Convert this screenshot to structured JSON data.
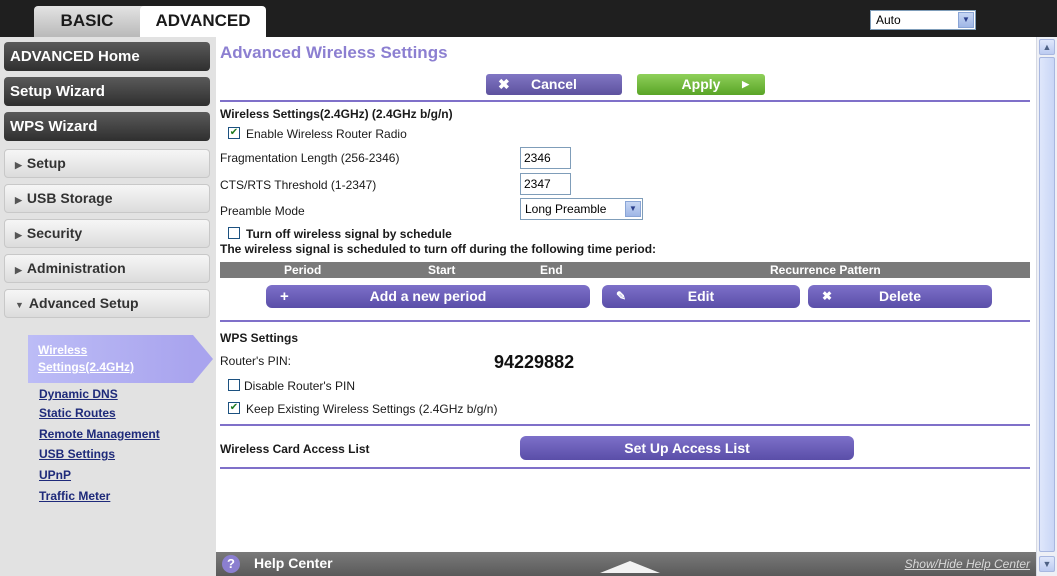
{
  "tabs": {
    "basic": "BASIC",
    "advanced": "ADVANCED"
  },
  "language": {
    "selected": "Auto"
  },
  "sidebar": {
    "main_items": [
      "ADVANCED Home",
      "Setup Wizard",
      "WPS Wizard"
    ],
    "sections": [
      "Setup",
      "USB Storage",
      "Security",
      "Administration",
      "Advanced Setup"
    ],
    "active_sub": "Wireless Settings(2.4GHz)",
    "sub_items": [
      "Dynamic DNS",
      "Static Routes",
      "Remote Management",
      "USB Settings",
      "UPnP",
      "Traffic Meter"
    ]
  },
  "page": {
    "title": "Advanced Wireless Settings",
    "cancel_label": "Cancel",
    "apply_label": "Apply"
  },
  "wireless": {
    "heading": "Wireless Settings(2.4GHz) (2.4GHz b/g/n)",
    "enable_radio_label": "Enable Wireless Router Radio",
    "enable_radio_checked": true,
    "frag_label": "Fragmentation Length (256-2346)",
    "frag_value": "2346",
    "cts_label": "CTS/RTS Threshold (1-2347)",
    "cts_value": "2347",
    "preamble_label": "Preamble Mode",
    "preamble_value": "Long Preamble",
    "schedule_label": "Turn off wireless signal by schedule",
    "schedule_checked": false,
    "schedule_note": "The wireless signal is scheduled to turn off during the following time period:",
    "columns": [
      "Period",
      "Start",
      "End",
      "Recurrence Pattern"
    ],
    "add_period": "Add a new period",
    "edit": "Edit",
    "delete": "Delete"
  },
  "wps": {
    "heading": "WPS Settings",
    "pin_label": "Router's PIN:",
    "pin_value": "94229882",
    "disable_pin_label": "Disable Router's PIN",
    "disable_pin_checked": false,
    "keep_label": "Keep Existing Wireless Settings (2.4GHz b/g/n)",
    "keep_checked": true
  },
  "access": {
    "label": "Wireless Card Access List",
    "button": "Set Up Access List"
  },
  "help": {
    "title": "Help Center",
    "toggle": "Show/Hide Help Center"
  },
  "colors": {
    "accent": "#8c7fd1",
    "apply": "#6ab531",
    "button": "#6a5fb8"
  }
}
